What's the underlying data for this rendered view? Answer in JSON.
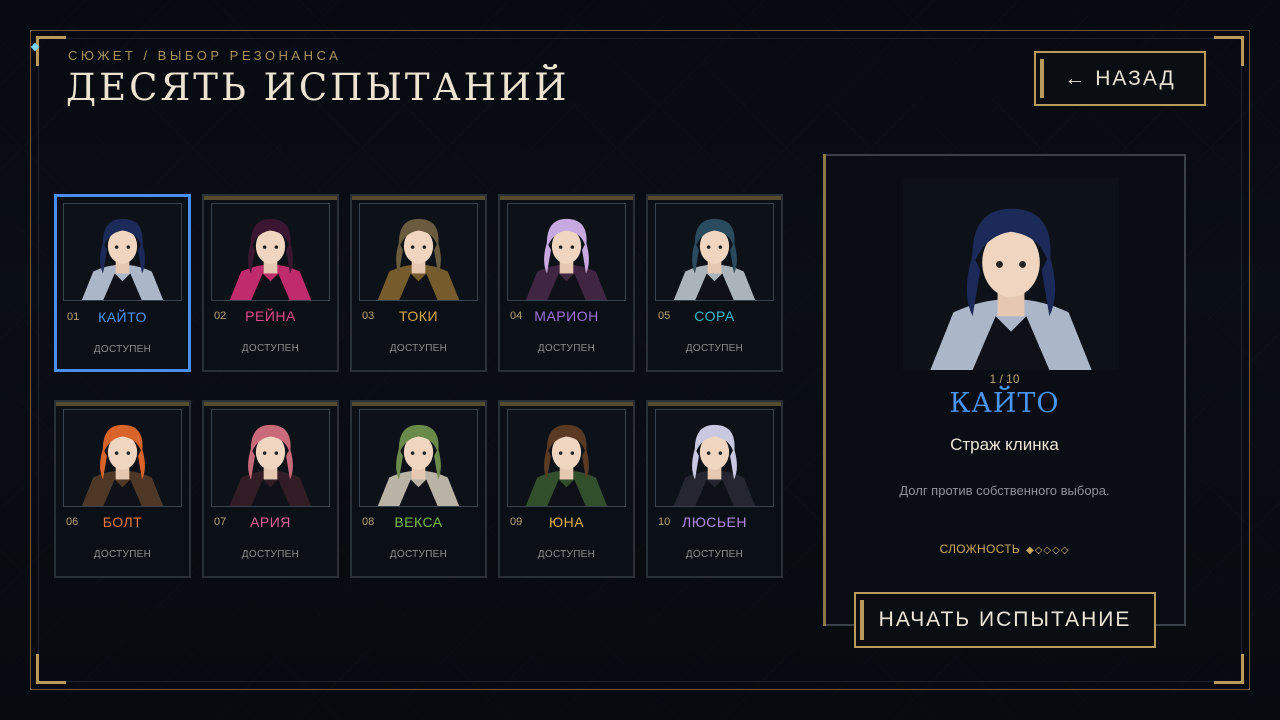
{
  "header": {
    "breadcrumb": "СЮЖЕТ / ВЫБОР РЕЗОНАНСА",
    "title": "ДЕСЯТЬ ИСПЫТАНИЙ",
    "back_label": "НАЗАД",
    "back_icon": "arrow-left-icon"
  },
  "characters": [
    {
      "num": "01",
      "name": "КАЙТО",
      "status": "ДОСТУПЕН",
      "color": "#4a94f2",
      "hair": "#1c2a5a",
      "accent": "#c8d4e8",
      "selected": true
    },
    {
      "num": "02",
      "name": "РЕЙНА",
      "status": "ДОСТУПЕН",
      "color": "#e0488a",
      "hair": "#3a1630",
      "accent": "#e0307a"
    },
    {
      "num": "03",
      "name": "ТОКИ",
      "status": "ДОСТУПЕН",
      "color": "#d6a64a",
      "hair": "#6a5a3e",
      "accent": "#8a6a30"
    },
    {
      "num": "04",
      "name": "МАРИОН",
      "status": "ДОСТУПЕН",
      "color": "#a070d8",
      "hair": "#c8a8e0",
      "accent": "#4a2a4a"
    },
    {
      "num": "05",
      "name": "СОРА",
      "status": "ДОСТУПЕН",
      "color": "#38b8c8",
      "hair": "#2a4a5e",
      "accent": "#c8d0d8"
    },
    {
      "num": "06",
      "name": "БОЛТ",
      "status": "ДОСТУПЕН",
      "color": "#e8783a",
      "hair": "#d8642a",
      "accent": "#5a4028"
    },
    {
      "num": "07",
      "name": "АРИЯ",
      "status": "ДОСТУПЕН",
      "color": "#e0609a",
      "hair": "#c86a7a",
      "accent": "#3a1e28"
    },
    {
      "num": "08",
      "name": "ВЕКСА",
      "status": "ДОСТУПЕН",
      "color": "#78b84a",
      "hair": "#6a8a4a",
      "accent": "#d8d0c0"
    },
    {
      "num": "09",
      "name": "ЮНА",
      "status": "ДОСТУПЕН",
      "color": "#d8b04a",
      "hair": "#5a3a22",
      "accent": "#3a5a30"
    },
    {
      "num": "10",
      "name": "ЛЮСЬЕН",
      "status": "ДОСТУПЕН",
      "color": "#b088e0",
      "hair": "#c8c8e0",
      "accent": "#2a2a36"
    }
  ],
  "detail": {
    "counter": "1 / 10",
    "name": "КАЙТО",
    "role": "Страж клинка",
    "description": "Долг против собственного выбора.",
    "difficulty_label": "СЛОЖНОСТЬ",
    "difficulty_dots": "◆◇◇◇◇",
    "difficulty_level": 1,
    "difficulty_max": 5
  },
  "start_label": "НАЧАТЬ ИСПЫТАНИЕ",
  "colors": {
    "gold": "#b89a5a",
    "selected": "#4a8ff0"
  }
}
